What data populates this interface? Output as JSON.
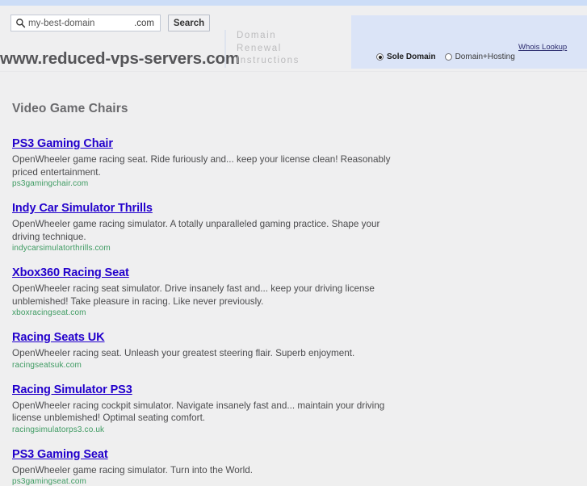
{
  "header": {
    "site_domain": "www.reduced-vps-servers.com",
    "renewal_lines": [
      "Domain",
      "Renewal",
      "Instructions"
    ]
  },
  "search": {
    "icon": "search-icon",
    "placeholder": "my-best-domain",
    "value": "",
    "tld_suffix": ".com",
    "search_button": "Search",
    "whois_link": "Whois Lookup",
    "options": [
      {
        "label": "Sole Domain",
        "selected": true
      },
      {
        "label": "Domain+Hosting",
        "selected": false
      }
    ]
  },
  "main": {
    "page_title": "Video Game Chairs",
    "results": [
      {
        "title": "PS3 Gaming Chair",
        "description": "OpenWheeler game racing seat. Ride furiously and... keep your license clean! Reasonably priced entertainment.",
        "url": "ps3gamingchair.com"
      },
      {
        "title": "Indy Car Simulator Thrills",
        "description": "OpenWheeler game racing simulator. A totally unparalleled gaming practice. Shape your driving technique.",
        "url": "indycarsimulatorthrills.com"
      },
      {
        "title": "Xbox360 Racing Seat",
        "description": "OpenWheeler racing seat simulator. Drive insanely fast and... keep your driving license unblemished! Take pleasure in racing. Like never previously.",
        "url": "xboxracingseat.com"
      },
      {
        "title": "Racing Seats UK",
        "description": "OpenWheeler racing seat. Unleash your greatest steering flair. Superb enjoyment.",
        "url": "racingseatsuk.com"
      },
      {
        "title": "Racing Simulator PS3",
        "description": "OpenWheeler racing cockpit simulator. Navigate insanely fast and... maintain your driving license unblemished! Optimal seating comfort.",
        "url": "racingsimulatorps3.co.uk"
      },
      {
        "title": "PS3 Gaming Seat",
        "description": "OpenWheeler game racing simulator. Turn into the World.",
        "url": "ps3gamingseat.com"
      }
    ]
  },
  "colors": {
    "top_strip": "#ccddf7",
    "page_bg": "#efeff0",
    "search_panel_bg": "#dbe4f7",
    "link": "#2200cc",
    "url_green": "#3e9b62",
    "title_gray": "#6a6a6d"
  }
}
